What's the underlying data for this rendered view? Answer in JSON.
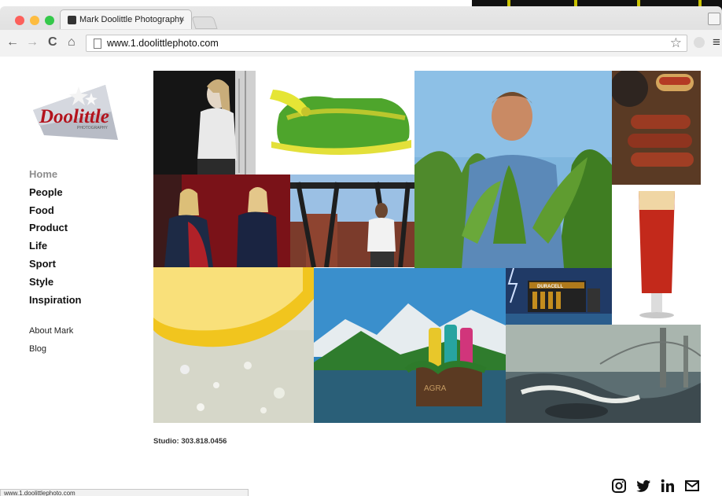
{
  "browser": {
    "tab_title": "Mark Doolittle Photography",
    "tab_close": "×",
    "url": "www.1.doolittlephoto.com",
    "nav": {
      "back": "←",
      "forward": "→",
      "reload": "C",
      "home": "⌂"
    },
    "menu": "≡",
    "bookmark": "☆"
  },
  "logo": {
    "main": "Doolittle",
    "sub": "PHOTOGRAPHY"
  },
  "sidebar": {
    "categories": [
      {
        "label": "Home",
        "active": true
      },
      {
        "label": "People"
      },
      {
        "label": "Food"
      },
      {
        "label": "Product"
      },
      {
        "label": "Life"
      },
      {
        "label": "Sport"
      },
      {
        "label": "Style"
      },
      {
        "label": "Inspiration"
      }
    ],
    "secondary": [
      "About Mark",
      "Blog"
    ]
  },
  "photos": {
    "dish_soap_crate": "AGRA",
    "battery_brand": "DURACELL"
  },
  "footer": {
    "studio": "Studio: 303.818.0456",
    "social_icons": [
      "instagram-icon",
      "twitter-icon",
      "linkedin-icon",
      "mail-icon"
    ]
  },
  "status_bar": "www.1.doolittlephoto.com"
}
